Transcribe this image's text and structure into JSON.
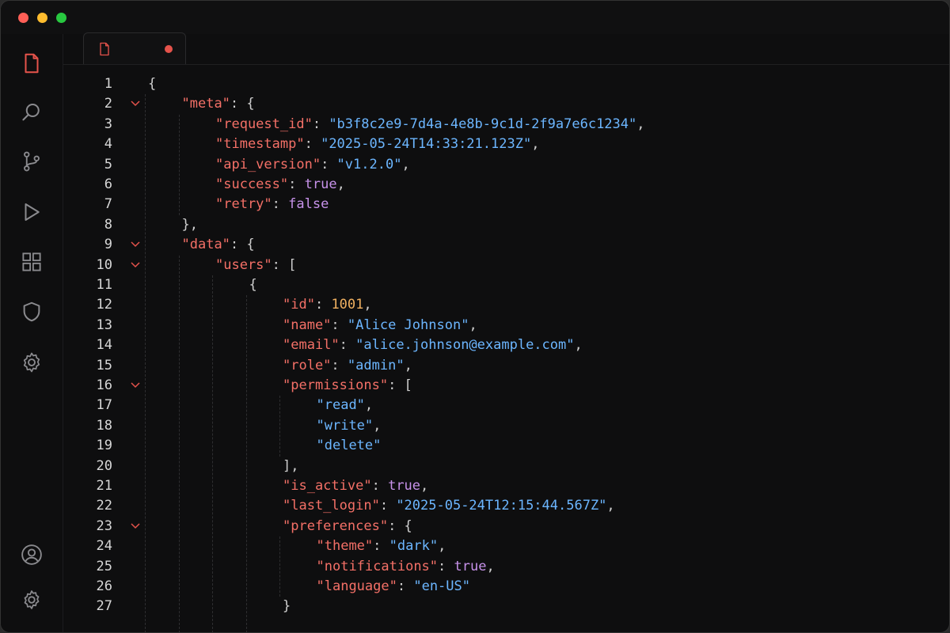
{
  "colors": {
    "close": "#ff5f57",
    "minimize": "#febc2e",
    "zoom": "#28c840",
    "accent": "#e5534b",
    "icon": "#8a8a8e",
    "key": "#f47067",
    "string": "#6cb6ff",
    "number": "#f0b060",
    "boolean": "#c792ea",
    "punct": "#cfcfcf",
    "fold": "#e5534b"
  },
  "activity": [
    {
      "name": "files-icon",
      "active": true
    },
    {
      "name": "search-icon",
      "active": false
    },
    {
      "name": "source-control-icon",
      "active": false
    },
    {
      "name": "run-icon",
      "active": false
    },
    {
      "name": "extensions-icon",
      "active": false
    },
    {
      "name": "shield-icon",
      "active": false
    },
    {
      "name": "settings-icon",
      "active": false
    }
  ],
  "activity_bottom": [
    {
      "name": "account-icon"
    },
    {
      "name": "manage-gear-icon"
    }
  ],
  "tab": {
    "icon": "file-icon",
    "modified": true
  },
  "lines": [
    {
      "n": "1",
      "indent": 0,
      "fold": false,
      "tokens": [
        [
          "p",
          "{"
        ]
      ]
    },
    {
      "n": "2",
      "indent": 1,
      "fold": true,
      "tokens": [
        [
          "k",
          "\"meta\""
        ],
        [
          "p",
          ": {"
        ]
      ]
    },
    {
      "n": "3",
      "indent": 2,
      "fold": false,
      "tokens": [
        [
          "k",
          "\"request_id\""
        ],
        [
          "p",
          ": "
        ],
        [
          "s",
          "\"b3f8c2e9-7d4a-4e8b-9c1d-2f9a7e6c1234\""
        ],
        [
          "p",
          ","
        ]
      ]
    },
    {
      "n": "4",
      "indent": 2,
      "fold": false,
      "tokens": [
        [
          "k",
          "\"timestamp\""
        ],
        [
          "p",
          ": "
        ],
        [
          "s",
          "\"2025-05-24T14:33:21.123Z\""
        ],
        [
          "p",
          ","
        ]
      ]
    },
    {
      "n": "5",
      "indent": 2,
      "fold": false,
      "tokens": [
        [
          "k",
          "\"api_version\""
        ],
        [
          "p",
          ": "
        ],
        [
          "s",
          "\"v1.2.0\""
        ],
        [
          "p",
          ","
        ]
      ]
    },
    {
      "n": "6",
      "indent": 2,
      "fold": false,
      "tokens": [
        [
          "k",
          "\"success\""
        ],
        [
          "p",
          ": "
        ],
        [
          "b",
          "true"
        ],
        [
          "p",
          ","
        ]
      ]
    },
    {
      "n": "7",
      "indent": 2,
      "fold": false,
      "tokens": [
        [
          "k",
          "\"retry\""
        ],
        [
          "p",
          ": "
        ],
        [
          "b",
          "false"
        ]
      ]
    },
    {
      "n": "8",
      "indent": 1,
      "fold": false,
      "tokens": [
        [
          "p",
          "},"
        ]
      ]
    },
    {
      "n": "9",
      "indent": 1,
      "fold": true,
      "tokens": [
        [
          "k",
          "\"data\""
        ],
        [
          "p",
          ": {"
        ]
      ]
    },
    {
      "n": "10",
      "indent": 2,
      "fold": true,
      "tokens": [
        [
          "k",
          "\"users\""
        ],
        [
          "p",
          ": ["
        ]
      ]
    },
    {
      "n": "11",
      "indent": 3,
      "fold": false,
      "tokens": [
        [
          "p",
          "{"
        ]
      ]
    },
    {
      "n": "12",
      "indent": 4,
      "fold": false,
      "tokens": [
        [
          "k",
          "\"id\""
        ],
        [
          "p",
          ": "
        ],
        [
          "n",
          "1001"
        ],
        [
          "p",
          ","
        ]
      ]
    },
    {
      "n": "13",
      "indent": 4,
      "fold": false,
      "tokens": [
        [
          "k",
          "\"name\""
        ],
        [
          "p",
          ": "
        ],
        [
          "s",
          "\"Alice Johnson\""
        ],
        [
          "p",
          ","
        ]
      ]
    },
    {
      "n": "14",
      "indent": 4,
      "fold": false,
      "tokens": [
        [
          "k",
          "\"email\""
        ],
        [
          "p",
          ": "
        ],
        [
          "s",
          "\"alice.johnson@example.com\""
        ],
        [
          "p",
          ","
        ]
      ]
    },
    {
      "n": "15",
      "indent": 4,
      "fold": false,
      "tokens": [
        [
          "k",
          "\"role\""
        ],
        [
          "p",
          ": "
        ],
        [
          "s",
          "\"admin\""
        ],
        [
          "p",
          ","
        ]
      ]
    },
    {
      "n": "16",
      "indent": 4,
      "fold": true,
      "tokens": [
        [
          "k",
          "\"permissions\""
        ],
        [
          "p",
          ": ["
        ]
      ]
    },
    {
      "n": "17",
      "indent": 5,
      "fold": false,
      "tokens": [
        [
          "s",
          "\"read\""
        ],
        [
          "p",
          ","
        ]
      ]
    },
    {
      "n": "18",
      "indent": 5,
      "fold": false,
      "tokens": [
        [
          "s",
          "\"write\""
        ],
        [
          "p",
          ","
        ]
      ]
    },
    {
      "n": "19",
      "indent": 5,
      "fold": false,
      "tokens": [
        [
          "s",
          "\"delete\""
        ]
      ]
    },
    {
      "n": "20",
      "indent": 4,
      "fold": false,
      "tokens": [
        [
          "p",
          "],"
        ]
      ]
    },
    {
      "n": "21",
      "indent": 4,
      "fold": false,
      "tokens": [
        [
          "k",
          "\"is_active\""
        ],
        [
          "p",
          ": "
        ],
        [
          "b",
          "true"
        ],
        [
          "p",
          ","
        ]
      ]
    },
    {
      "n": "22",
      "indent": 4,
      "fold": false,
      "tokens": [
        [
          "k",
          "\"last_login\""
        ],
        [
          "p",
          ": "
        ],
        [
          "s",
          "\"2025-05-24T12:15:44.567Z\""
        ],
        [
          "p",
          ","
        ]
      ]
    },
    {
      "n": "23",
      "indent": 4,
      "fold": true,
      "tokens": [
        [
          "k",
          "\"preferences\""
        ],
        [
          "p",
          ": {"
        ]
      ]
    },
    {
      "n": "24",
      "indent": 5,
      "fold": false,
      "tokens": [
        [
          "k",
          "\"theme\""
        ],
        [
          "p",
          ": "
        ],
        [
          "s",
          "\"dark\""
        ],
        [
          "p",
          ","
        ]
      ]
    },
    {
      "n": "25",
      "indent": 5,
      "fold": false,
      "tokens": [
        [
          "k",
          "\"notifications\""
        ],
        [
          "p",
          ": "
        ],
        [
          "b",
          "true"
        ],
        [
          "p",
          ","
        ]
      ]
    },
    {
      "n": "26",
      "indent": 5,
      "fold": false,
      "tokens": [
        [
          "k",
          "\"language\""
        ],
        [
          "p",
          ": "
        ],
        [
          "s",
          "\"en-US\""
        ]
      ]
    },
    {
      "n": "27",
      "indent": 4,
      "fold": false,
      "tokens": [
        [
          "p",
          "}"
        ]
      ]
    }
  ]
}
